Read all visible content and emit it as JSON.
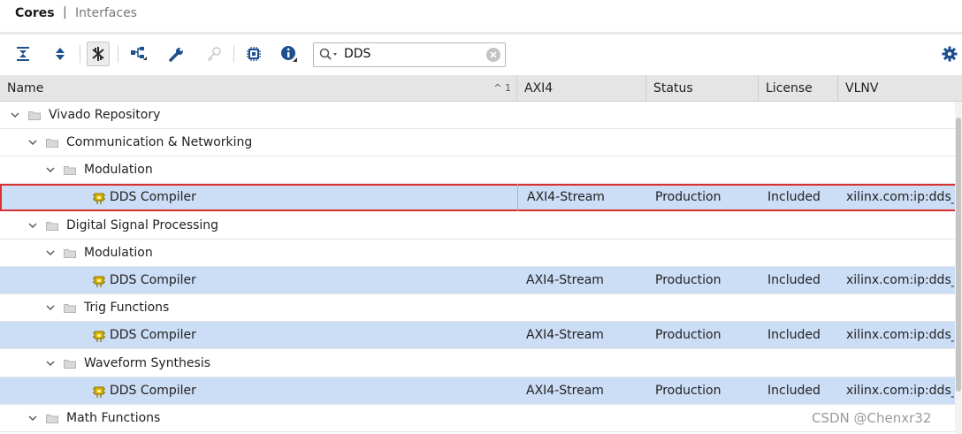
{
  "tabs": {
    "active": "Cores",
    "separator": "|",
    "other": "Interfaces"
  },
  "toolbar": {
    "icons": [
      "collapse-all-icon",
      "expand-all-icon",
      "filter-toggle-icon",
      "hierarchy-icon",
      "wrench-icon",
      "key-icon",
      "chip-icon",
      "info-icon"
    ],
    "search_value": "DDS",
    "accent": "#1f4f8f"
  },
  "columns": {
    "name": "Name",
    "sort_indicator": "^ 1",
    "axi": "AXI4",
    "status": "Status",
    "license": "License",
    "vlnv": "VLNV"
  },
  "rows": [
    {
      "type": "group",
      "label": "Vivado Repository"
    },
    {
      "type": "group",
      "label": "Communication & Networking"
    },
    {
      "type": "group",
      "label": "Modulation"
    },
    {
      "type": "ip",
      "label": "DDS Compiler",
      "axi": "AXI4-Stream",
      "status": "Production",
      "license": "Included",
      "vlnv": "xilinx.com:ip:dds_"
    },
    {
      "type": "group",
      "label": "Digital Signal Processing"
    },
    {
      "type": "group",
      "label": "Modulation"
    },
    {
      "type": "ip",
      "label": "DDS Compiler",
      "axi": "AXI4-Stream",
      "status": "Production",
      "license": "Included",
      "vlnv": "xilinx.com:ip:dds_"
    },
    {
      "type": "group",
      "label": "Trig Functions"
    },
    {
      "type": "ip",
      "label": "DDS Compiler",
      "axi": "AXI4-Stream",
      "status": "Production",
      "license": "Included",
      "vlnv": "xilinx.com:ip:dds_"
    },
    {
      "type": "group",
      "label": "Waveform Synthesis"
    },
    {
      "type": "ip",
      "label": "DDS Compiler",
      "axi": "AXI4-Stream",
      "status": "Production",
      "license": "Included",
      "vlnv": "xilinx.com:ip:dds_"
    },
    {
      "type": "group",
      "label": "Math Functions"
    }
  ],
  "colors": {
    "selected_row": "#ccddf6",
    "highlight_border": "#d9312f",
    "ip_icon": "#d8b400"
  },
  "watermark": "CSDN @Chenxr32"
}
